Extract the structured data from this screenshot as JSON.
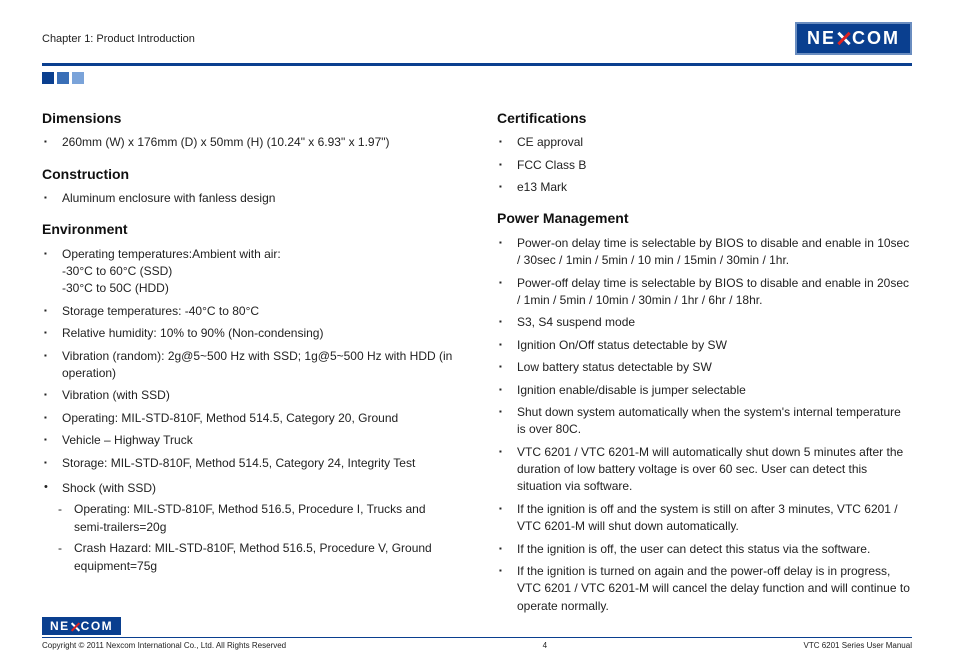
{
  "header": {
    "chapter": "Chapter 1: Product Introduction",
    "logo_left": "NE",
    "logo_right": "COM"
  },
  "left": {
    "dimensions_heading": "Dimensions",
    "dimensions_item": "260mm (W) x 176mm (D) x 50mm (H) (10.24\" x 6.93\" x 1.97\")",
    "construction_heading": "Construction",
    "construction_item": "Aluminum enclosure with fanless design",
    "environment_heading": "Environment",
    "env_optemp_label": "Operating temperatures:Ambient with air:",
    "env_optemp_ssd": "-30°C to 60°C (SSD)",
    "env_optemp_hdd": "-30°C to 50C (HDD)",
    "env_storage_temp": "Storage temperatures: -40°C to 80°C",
    "env_humidity": "Relative humidity: 10% to 90% (Non-condensing)",
    "env_vibration_random": "Vibration (random): 2g@5~500 Hz with SSD; 1g@5~500 Hz with HDD (in operation)",
    "env_vibration_ssd": "Vibration (with SSD)",
    "env_operating": "Operating: MIL-STD-810F, Method 514.5, Category 20, Ground",
    "env_vehicle": "Vehicle – Highway Truck",
    "env_storage": "Storage: MIL-STD-810F, Method 514.5, Category 24, Integrity Test",
    "env_shock": "Shock (with SSD)",
    "env_shock_op": "Operating: MIL-STD-810F, Method 516.5, Procedure I, Trucks and semi-trailers=20g",
    "env_shock_crash": "Crash Hazard: MIL-STD-810F, Method 516.5, Procedure V, Ground equipment=75g"
  },
  "right": {
    "certifications_heading": "Certifications",
    "cert_ce": "CE approval",
    "cert_fcc": "FCC Class B",
    "cert_e13": "e13 Mark",
    "power_heading": "Power Management",
    "pm_on_delay": "Power-on delay time is selectable by BIOS to disable and enable in 10sec / 30sec / 1min / 5min / 10 min / 15min / 30min / 1hr.",
    "pm_off_delay": "Power-off delay time is selectable by BIOS to disable and enable in 20sec / 1min / 5min / 10min / 30min / 1hr / 6hr / 18hr.",
    "pm_suspend": "S3, S4 suspend mode",
    "pm_ignition_status": "Ignition On/Off status detectable by SW",
    "pm_low_battery": "Low battery status detectable by SW",
    "pm_ignition_jumper": "Ignition enable/disable is jumper selectable",
    "pm_shutdown_temp": "Shut down system automatically when the system's internal temperature is over 80C.",
    "pm_vtc_shutdown": "VTC 6201 / VTC 6201-M will automatically shut down 5 minutes after the duration of low battery voltage is over 60 sec. User can detect this situation via software.",
    "pm_ignition_off": "If the ignition is off and the system is still on after 3 minutes, VTC 6201 / VTC 6201-M will shut down automatically.",
    "pm_ignition_detect": "If the ignition is off, the user can detect this status via the software.",
    "pm_ignition_on_again": "If the ignition is turned on again and the power-off delay is in progress, VTC 6201 / VTC 6201-M will cancel the delay function and will continue to operate normally."
  },
  "footer": {
    "copyright": "Copyright © 2011 Nexcom International Co., Ltd. All Rights Reserved",
    "page": "4",
    "manual": "VTC 6201 Series User Manual"
  }
}
